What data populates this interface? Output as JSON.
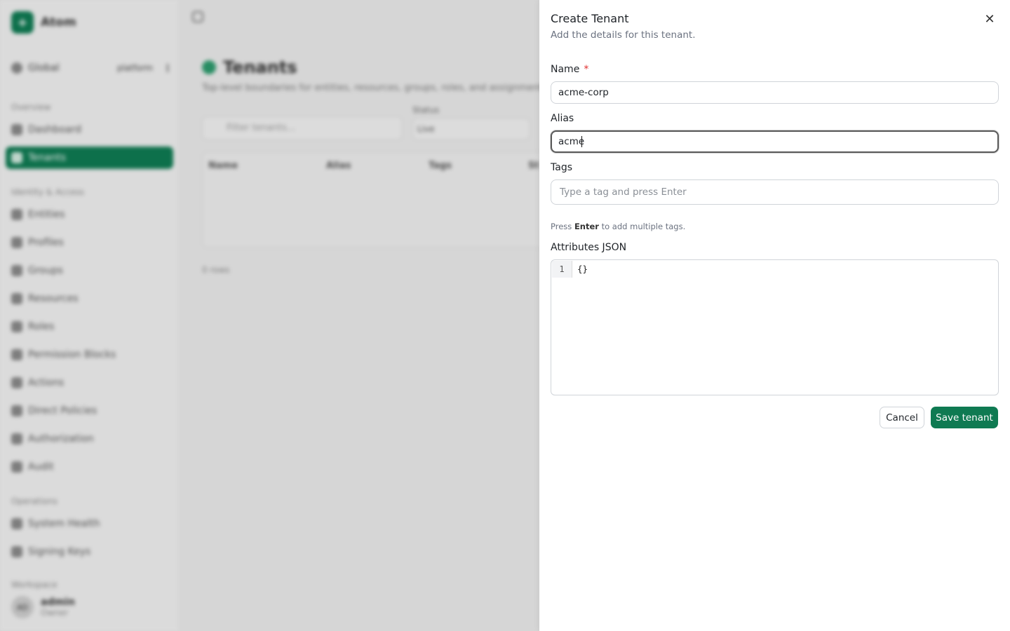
{
  "app": {
    "brand": "Atom",
    "scope": {
      "label": "Global",
      "badge": "platform"
    },
    "nav_groups": [
      "Overview",
      "Identity & Access",
      "Operations",
      "Workspace"
    ],
    "nav_items": [
      {
        "label": "Dashboard",
        "icon": "dashboard-icon"
      },
      {
        "label": "Tenants",
        "icon": "tenants-icon",
        "active": true
      },
      {
        "label": "Entities",
        "icon": "entities-icon"
      },
      {
        "label": "Profiles",
        "icon": "profiles-icon"
      },
      {
        "label": "Groups",
        "icon": "groups-icon"
      },
      {
        "label": "Resources",
        "icon": "resources-icon"
      },
      {
        "label": "Roles",
        "icon": "roles-icon"
      },
      {
        "label": "Permission Blocks",
        "icon": "permission-blocks-icon"
      },
      {
        "label": "Actions",
        "icon": "actions-icon"
      },
      {
        "label": "Direct Policies",
        "icon": "direct-policies-icon"
      },
      {
        "label": "Authorization",
        "icon": "authorization-icon"
      },
      {
        "label": "Audit",
        "icon": "audit-icon"
      },
      {
        "label": "System Health",
        "icon": "system-health-icon"
      },
      {
        "label": "Signing Keys",
        "icon": "signing-keys-icon"
      }
    ],
    "user": {
      "initials": "AD",
      "name": "admin",
      "role": "Owner"
    }
  },
  "page": {
    "title": "Tenants",
    "subtitle": "Top-level boundaries for entities, resources, groups, roles, and assignments.",
    "filter_placeholder": "Filter tenants...",
    "status_label": "Status",
    "status_value": "Live",
    "columns": [
      "Name",
      "Alias",
      "Tags",
      "St"
    ],
    "rows_info": "0 rows"
  },
  "drawer": {
    "title": "Create Tenant",
    "subtitle": "Add the details for this tenant.",
    "name_label": "Name",
    "required_mark": "*",
    "name_value": "acme-corp",
    "alias_label": "Alias",
    "alias_value": "acme",
    "tags_label": "Tags",
    "tags_placeholder": "Type a tag and press Enter",
    "hint_prefix": "Press",
    "hint_key": "Enter",
    "hint_suffix": "to add multiple tags.",
    "attributes_label": "Attributes JSON",
    "editor_line": "1",
    "editor_code": "{}",
    "cancel_label": "Cancel",
    "save_label": "Save tenant"
  },
  "colors": {
    "accent": "#0f7a52",
    "required": "#e03131"
  }
}
